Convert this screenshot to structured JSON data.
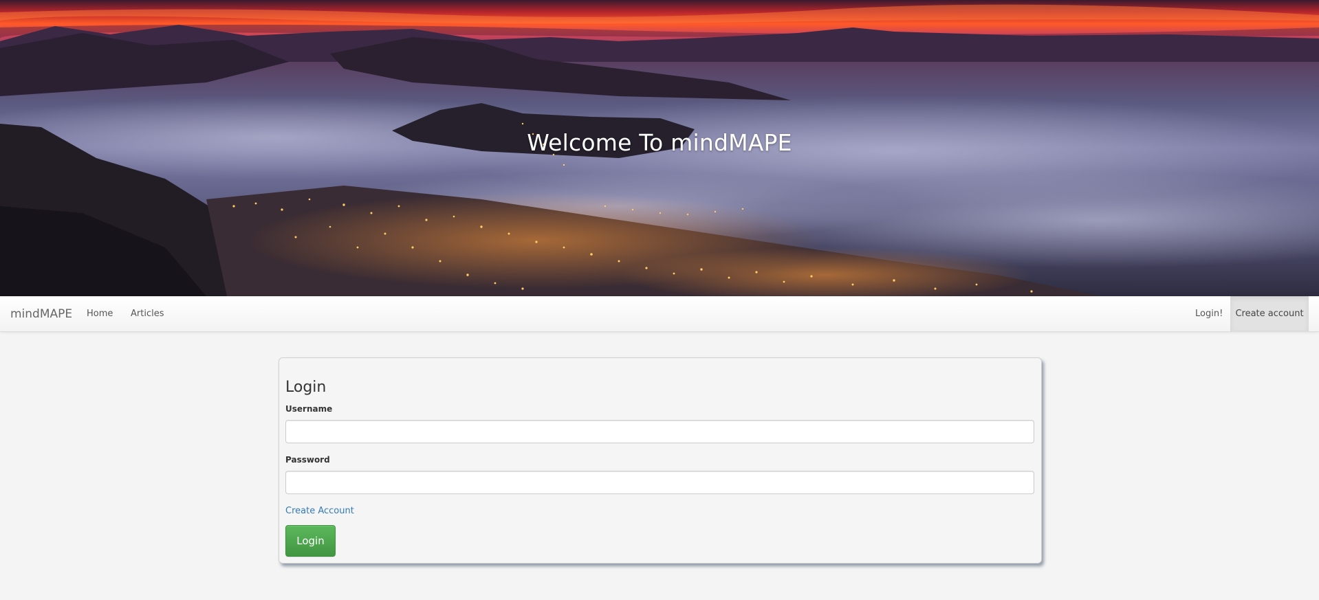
{
  "hero": {
    "title": "Welcome To mindMAPE"
  },
  "navbar": {
    "brand": "mindMAPE",
    "links": [
      {
        "label": "Home"
      },
      {
        "label": "Articles"
      }
    ],
    "right_links": [
      {
        "label": "Login!"
      },
      {
        "label": "Create account"
      }
    ]
  },
  "login_form": {
    "title": "Login",
    "username_label": "Username",
    "username_value": "",
    "password_label": "Password",
    "password_value": "",
    "create_account_link": "Create Account",
    "submit_label": "Login"
  },
  "colors": {
    "page_background": "#f4f4f4",
    "link": "#337ab7",
    "login_button": "#5cb85c",
    "active_nav": "#e2e2e2"
  }
}
